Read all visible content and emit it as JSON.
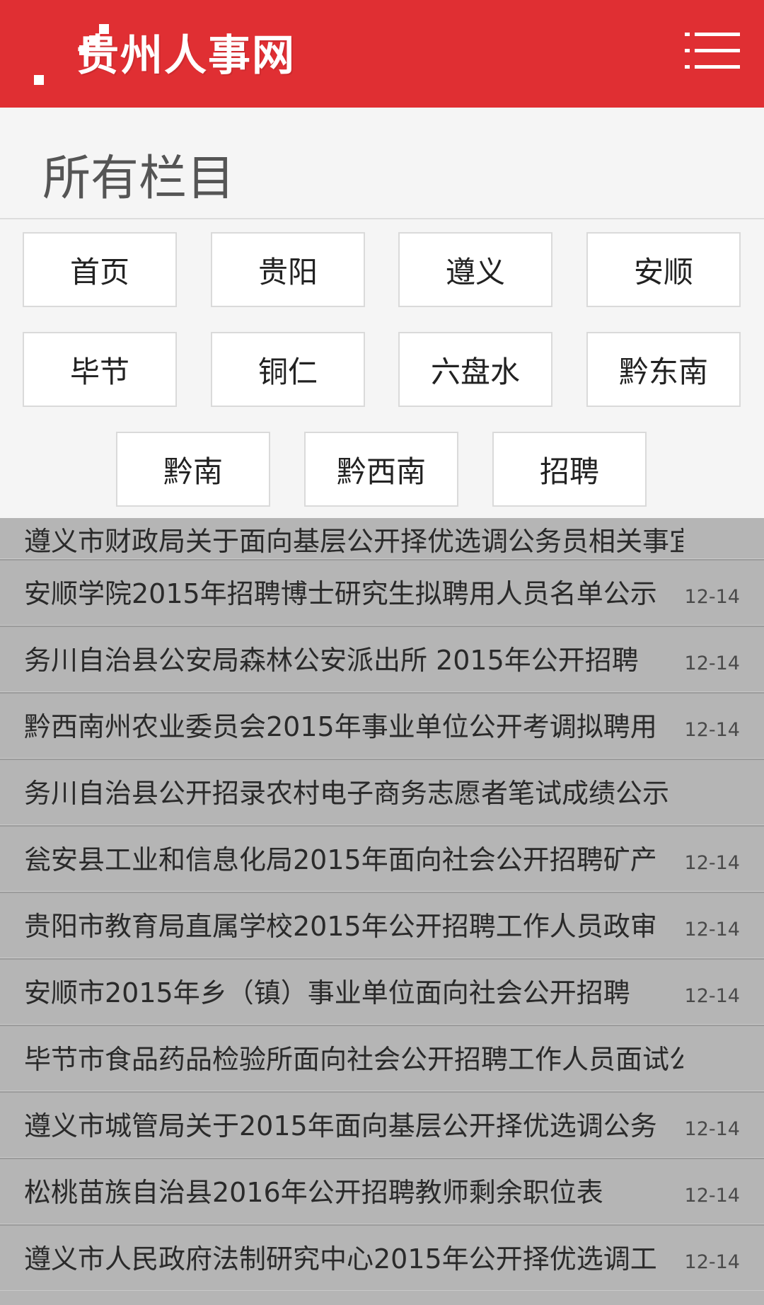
{
  "header": {
    "logo_text": "贵州人事网",
    "menu_icon": "menu-icon",
    "brand_color": "#e02f33"
  },
  "panel": {
    "title": "所有栏目",
    "categories": [
      "首页",
      "贵阳",
      "遵义",
      "安顺",
      "毕节",
      "铜仁",
      "六盘水",
      "黔东南",
      "黔南",
      "黔西南",
      "招聘"
    ]
  },
  "news": {
    "partial_title": "遵义市财政局关于面向基层公开择优选调公务员相关事宜",
    "items": [
      {
        "title": "安顺学院2015年招聘博士研究生拟聘用人员名单公示",
        "date": "12-14"
      },
      {
        "title": "务川自治县公安局森林公安派出所 2015年公开招聘",
        "date": "12-14"
      },
      {
        "title": "黔西南州农业委员会2015年事业单位公开考调拟聘用",
        "date": "12-14"
      },
      {
        "title": "务川自治县公开招录农村电子商务志愿者笔试成绩公示",
        "date": ""
      },
      {
        "title": "瓮安县工业和信息化局2015年面向社会公开招聘矿产",
        "date": "12-14"
      },
      {
        "title": "贵阳市教育局直属学校2015年公开招聘工作人员政审",
        "date": "12-14"
      },
      {
        "title": "安顺市2015年乡（镇）事业单位面向社会公开招聘",
        "date": "12-14"
      },
      {
        "title": "毕节市食品药品检验所面向社会公开招聘工作人员面试公",
        "date": ""
      },
      {
        "title": "遵义市城管局关于2015年面向基层公开择优选调公务",
        "date": "12-14"
      },
      {
        "title": "松桃苗族自治县2016年公开招聘教师剩余职位表",
        "date": "12-14"
      },
      {
        "title": "遵义市人民政府法制研究中心2015年公开择优选调工",
        "date": "12-14"
      }
    ]
  }
}
